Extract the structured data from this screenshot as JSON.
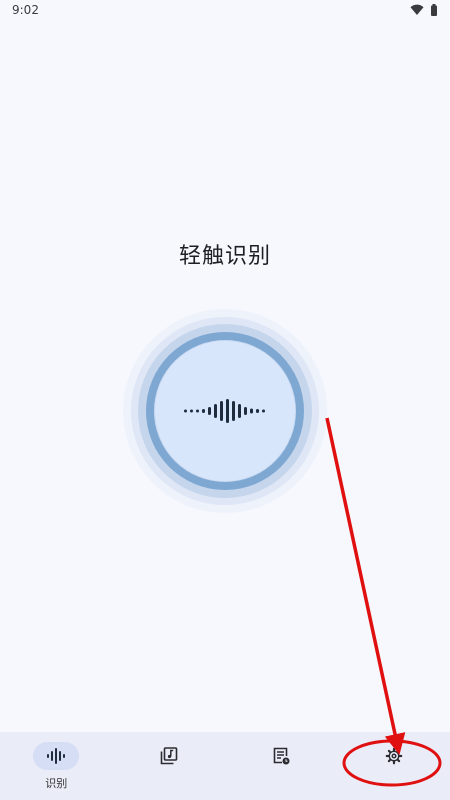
{
  "status_bar": {
    "time": "9:02",
    "icons": [
      "wifi-icon",
      "battery-icon"
    ]
  },
  "main": {
    "title": "轻触识别",
    "button_icon": "audio-wave-icon"
  },
  "nav": {
    "items": [
      {
        "label": "识别",
        "icon": "audio-wave-icon",
        "active": true
      },
      {
        "label": "",
        "icon": "music-library-icon",
        "active": false
      },
      {
        "label": "",
        "icon": "history-list-icon",
        "active": false
      },
      {
        "label": "",
        "icon": "gear-icon",
        "active": false
      }
    ]
  },
  "colors": {
    "background": "#f7f8fd",
    "accent": "#7ea7d2",
    "button_face": "#d8e6fb",
    "nav_background": "#eaedf8",
    "annotation": "#e01010"
  }
}
